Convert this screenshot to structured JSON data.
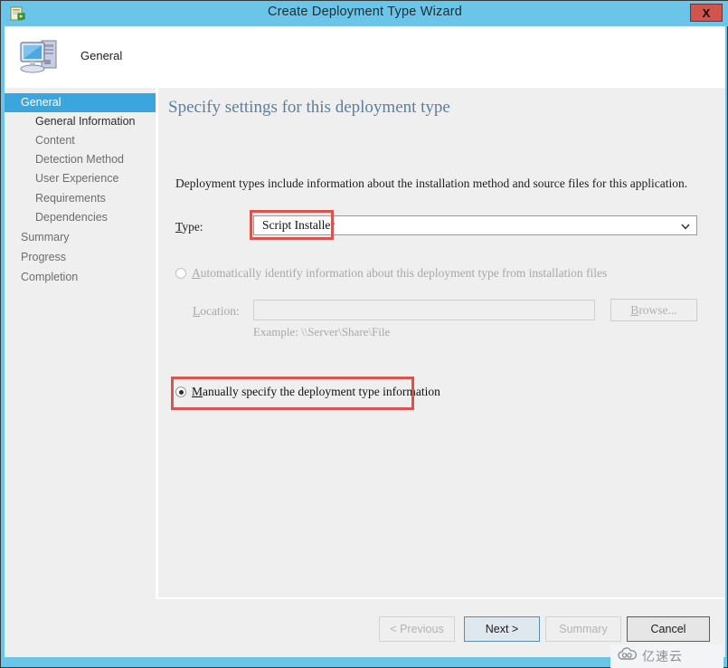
{
  "titlebar": {
    "title": "Create Deployment Type Wizard",
    "icon": "deployment-type-icon",
    "close_label": "X"
  },
  "header": {
    "title": "General",
    "icon": "computer-icon"
  },
  "sidebar": {
    "items": [
      {
        "label": "General",
        "state": "selected",
        "indent": false
      },
      {
        "label": "General Information",
        "state": "emphasis",
        "indent": true
      },
      {
        "label": "Content",
        "state": "normal",
        "indent": true
      },
      {
        "label": "Detection Method",
        "state": "normal",
        "indent": true
      },
      {
        "label": "User Experience",
        "state": "normal",
        "indent": true
      },
      {
        "label": "Requirements",
        "state": "normal",
        "indent": true
      },
      {
        "label": "Dependencies",
        "state": "normal",
        "indent": true
      },
      {
        "label": "Summary",
        "state": "normal",
        "indent": false
      },
      {
        "label": "Progress",
        "state": "normal",
        "indent": false
      },
      {
        "label": "Completion",
        "state": "normal",
        "indent": false
      }
    ]
  },
  "main": {
    "heading": "Specify settings for this deployment type",
    "intro": "Deployment types include information about the installation method and source files for this application.",
    "type_field": {
      "label": "Type:",
      "value": "Script Installer",
      "arrow_icon": "chevron-down-icon"
    },
    "auto_option": {
      "label": "Automatically identify information about this deployment type from installation files",
      "mnemonic": "A",
      "selected": false,
      "enabled": false
    },
    "location_field": {
      "label": "Location:",
      "mnemonic": "L",
      "value": "",
      "placeholder": "",
      "enabled": false
    },
    "browse_button": {
      "label": "Browse...",
      "mnemonic": "B",
      "enabled": false
    },
    "example_text": "Example: \\\\Server\\Share\\File",
    "manual_option": {
      "label": "Manually specify the deployment type information",
      "mnemonic": "M",
      "selected": true,
      "enabled": true
    }
  },
  "footer": {
    "buttons": [
      {
        "label": "< Previous",
        "state": "disabled"
      },
      {
        "label": "Next >",
        "state": "focus"
      },
      {
        "label": "Summary",
        "state": "disabled"
      },
      {
        "label": "Cancel",
        "state": "enabled"
      }
    ]
  },
  "watermark": {
    "text": "亿速云",
    "icon": "cloud-logo-icon"
  },
  "colors": {
    "titlebar": "#6ac5e8",
    "accent_selected": "#3aa6dd",
    "heading": "#5c7f9e",
    "annotation_red": "#d9534f",
    "close_red": "#d2544e",
    "panel_gray": "#efefef"
  }
}
